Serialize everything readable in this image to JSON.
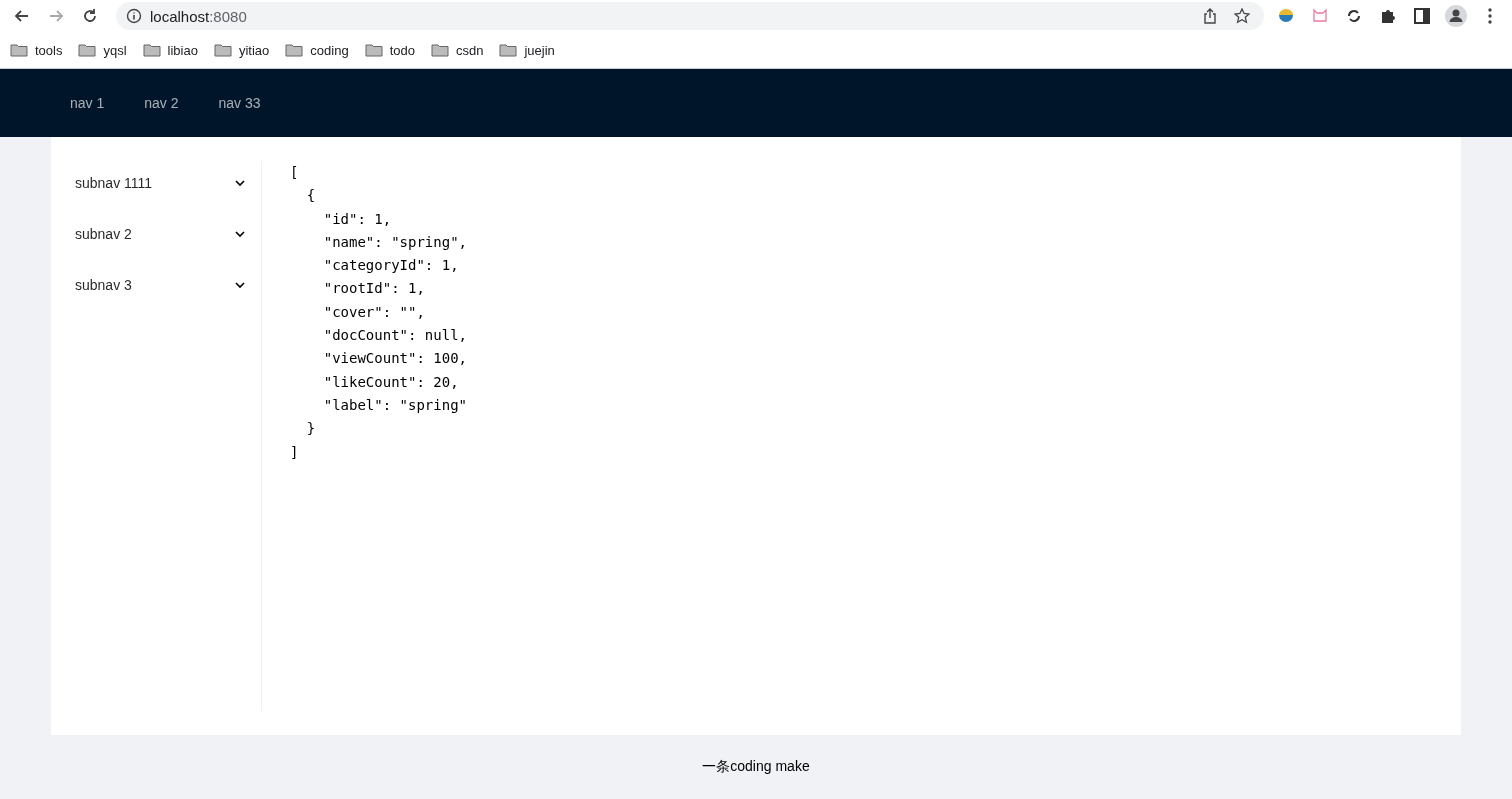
{
  "browser": {
    "url_host": "localhost",
    "url_port": ":8080",
    "bookmarks": [
      "tools",
      "yqsl",
      "libiao",
      "yitiao",
      "coding",
      "todo",
      "csdn",
      "juejin"
    ]
  },
  "header": {
    "nav": [
      {
        "label": "nav 1",
        "selected": false
      },
      {
        "label": "nav 2",
        "selected": false
      },
      {
        "label": "nav 33",
        "selected": false
      }
    ]
  },
  "sidebar": {
    "items": [
      {
        "label": "subnav 1111",
        "expanded": false
      },
      {
        "label": "subnav 2",
        "expanded": false
      },
      {
        "label": "subnav 3",
        "expanded": false
      }
    ]
  },
  "content": {
    "code_lines": [
      "[",
      "  {",
      "    \"id\": 1,",
      "    \"name\": \"spring\",",
      "    \"categoryId\": 1,",
      "    \"rootId\": 1,",
      "    \"cover\": \"\",",
      "    \"docCount\": null,",
      "    \"viewCount\": 100,",
      "    \"likeCount\": 20,",
      "    \"label\": \"spring\"",
      "  }",
      "]"
    ]
  },
  "footer": {
    "text": "一条coding make"
  }
}
